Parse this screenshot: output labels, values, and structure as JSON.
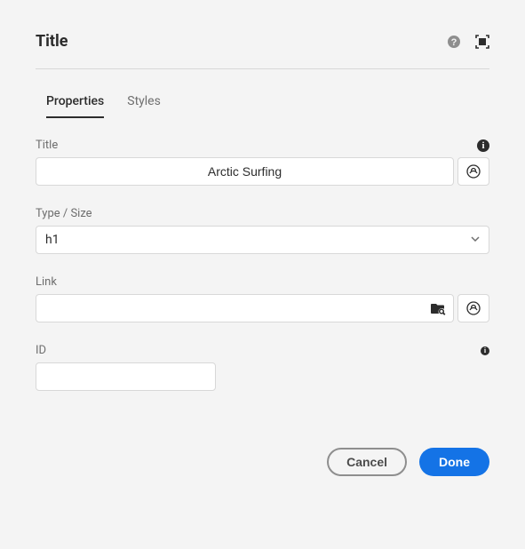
{
  "header": {
    "title": "Title"
  },
  "tabs": [
    {
      "label": "Properties",
      "active": true
    },
    {
      "label": "Styles",
      "active": false
    }
  ],
  "fields": {
    "title": {
      "label": "Title",
      "value": "Arctic Surfing"
    },
    "typeSize": {
      "label": "Type / Size",
      "value": "h1"
    },
    "link": {
      "label": "Link",
      "value": ""
    },
    "id": {
      "label": "ID",
      "value": ""
    }
  },
  "buttons": {
    "cancel": "Cancel",
    "done": "Done"
  }
}
